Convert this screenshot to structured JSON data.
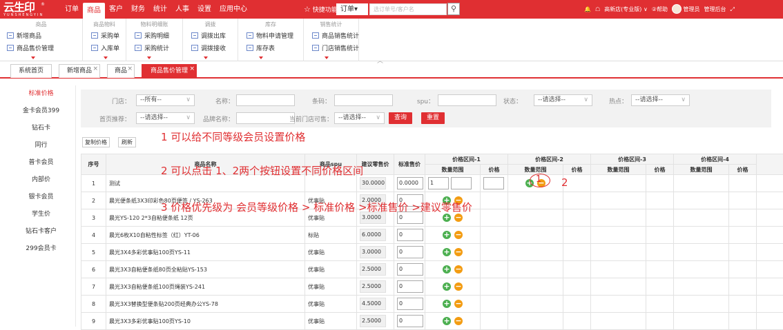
{
  "app": {
    "logo_text": "云生印",
    "logo_sub": "YUNSHENGYIN",
    "logo_reg": "®",
    "nav": [
      "订单",
      "商品",
      "客户",
      "财务",
      "统计",
      "人事",
      "设置",
      "应用中心"
    ],
    "nav_active": 1,
    "quick_label": "快捷功能",
    "order_select": "订单",
    "search_placeholder": "选订单号/客户名",
    "search_glyph": "⚲",
    "store_label": "高新店(专业版)",
    "help_label": "②帮助",
    "user_label": "管理员",
    "admin_label": "管理后台",
    "bell": "🔔",
    "cloud": "☖",
    "chev": "∨",
    "expand": "⤢"
  },
  "toolbar": {
    "groups": [
      {
        "title": "商品",
        "items": [
          "新增商品",
          "商品售价管理"
        ]
      },
      {
        "title": "商品物料",
        "items": [
          "采购单",
          "入库单"
        ]
      },
      {
        "title": "物料明细账",
        "items": [
          "采购明细",
          "采购统计"
        ]
      },
      {
        "title": "调拨",
        "items": [
          "调拨出库",
          "调拨接收"
        ]
      },
      {
        "title": "库存",
        "items": [
          "物料申请管理",
          "库存表"
        ]
      },
      {
        "title": "销售统计",
        "items": [
          "商品销售统计",
          "门店销售统计"
        ]
      }
    ],
    "collapse": "︿"
  },
  "tabs": [
    {
      "label": "系统首页",
      "closable": false
    },
    {
      "label": "新增商品",
      "closable": true
    },
    {
      "label": "商品",
      "closable": true
    },
    {
      "label": "商品售价管理",
      "closable": true
    }
  ],
  "tab_close": "×",
  "sidebar": [
    "标准价格",
    "金卡会员399",
    "钻石卡",
    "同行",
    "普卡会员",
    "内部价",
    "银卡会员",
    "学生价",
    "钻石卡客户",
    "299会员卡"
  ],
  "filter": {
    "store_label": "门店：",
    "store_value": "--所有--",
    "name_label": "名称：",
    "barcode_label": "条码：",
    "spu_label": "spu：",
    "status_label": "状态：",
    "status_value": "--请选择--",
    "hot_label": "热点：",
    "hot_value": "--请选择--",
    "recommend_label": "首页推荐：",
    "recommend_value": "--请选择--",
    "brand_label": "品牌名称：",
    "sellable_label": "当前门店可售：",
    "sellable_value": "--请选择--",
    "query_btn": "查询",
    "reset_btn": "重置",
    "caret": "∨"
  },
  "actions": {
    "copy": "复制价格",
    "refresh": "刷新"
  },
  "annotations": [
    "1 可以给不同等级会员设置价格",
    "2 可以点击 1、2两个按钮设置不同价格区间",
    "3 价格优先级为  会员等级价格 > 标准价格  >标准售价 >建议零售价"
  ],
  "mark_1": "1",
  "mark_2": "2",
  "table": {
    "headers": {
      "no": "序号",
      "name": "商品名称",
      "spu": "商品spu",
      "suggest": "建议零售价",
      "std": "标准售价",
      "range1": "价格区间-1",
      "range2": "价格区间-2",
      "range3": "价格区间-3",
      "range4": "价格区间-4",
      "qty": "数量范围",
      "price": "价格"
    },
    "rows": [
      {
        "no": "1",
        "name": "测试",
        "spu": "",
        "suggest": "30.0000",
        "std": "0.0000",
        "qmin": "1"
      },
      {
        "no": "2",
        "name": "晨光便条纸3X3印彩色80页便签 / YS-263",
        "spu": "优事贴",
        "suggest": "2.0000",
        "std": "0"
      },
      {
        "no": "3",
        "name": "晨光YS-120 2*3自粘便条纸 12页",
        "spu": "优事贴",
        "suggest": "3.0000",
        "std": "0"
      },
      {
        "no": "4",
        "name": "晨光6枚X10自粘性标签（红）YT-06",
        "spu": "标贴",
        "suggest": "6.0000",
        "std": "0"
      },
      {
        "no": "5",
        "name": "晨光3X4多彩优事贴100页YS-11",
        "spu": "优事贴",
        "suggest": "3.0000",
        "std": "0"
      },
      {
        "no": "6",
        "name": "晨光3X3自粘便条纸80页全粘贴YS-153",
        "spu": "优事贴",
        "suggest": "2.5000",
        "std": "0"
      },
      {
        "no": "7",
        "name": "晨光3X3自粘便条纸100页绳装YS-241",
        "spu": "优事贴",
        "suggest": "2.5000",
        "std": "0"
      },
      {
        "no": "8",
        "name": "晨光3X3替换型便条贴200页经典办公YS-78",
        "spu": "优事贴",
        "suggest": "4.5000",
        "std": "0"
      },
      {
        "no": "9",
        "name": "晨光3X3多彩优事贴100页YS-10",
        "spu": "优事贴",
        "suggest": "2.5000",
        "std": "0"
      }
    ]
  },
  "glyph_plus": "+",
  "glyph_minus": "−",
  "colors": {
    "brand": "#e02f32",
    "plus": "#4caf50",
    "minus": "#f39c12"
  }
}
